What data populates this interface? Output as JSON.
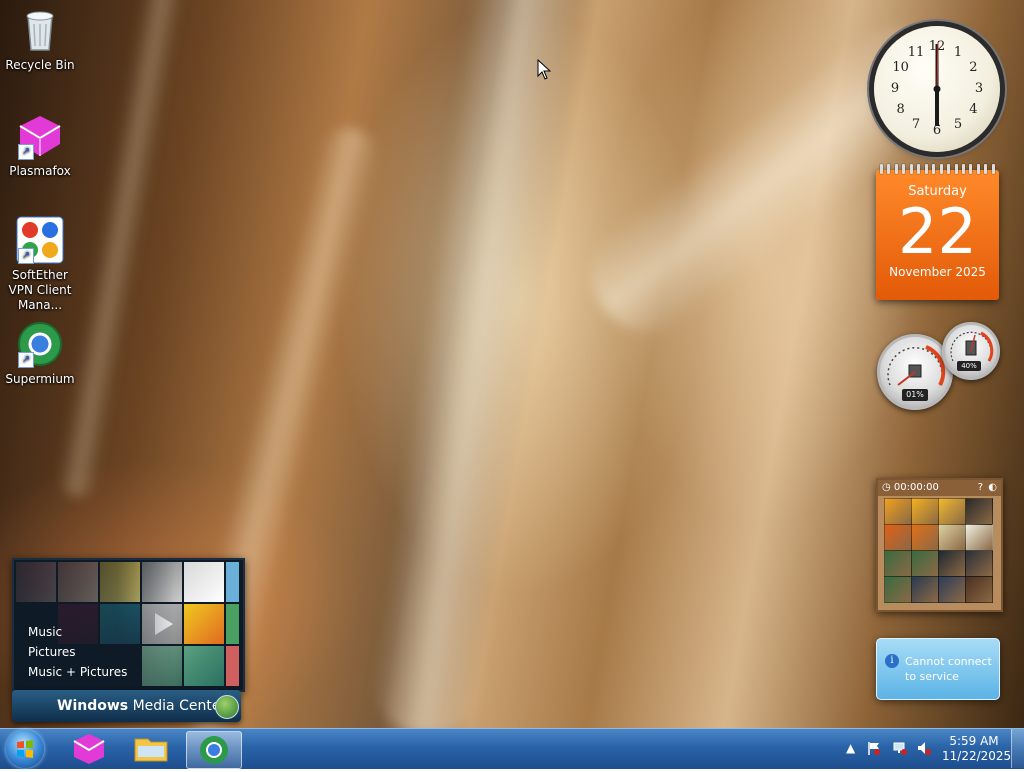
{
  "desktop_icons": [
    {
      "label": "Recycle Bin",
      "icon": "recycle-bin-icon"
    },
    {
      "label": "Plasmafox",
      "icon": "plasmafox-icon"
    },
    {
      "label": "SoftEther VPN Client Mana...",
      "icon": "softether-vpn-icon"
    },
    {
      "label": "Supermium",
      "icon": "supermium-icon"
    }
  ],
  "calendar": {
    "weekday": "Saturday",
    "day": "22",
    "month_year": "November 2025"
  },
  "clock": {
    "numerals": [
      "12",
      "1",
      "2",
      "3",
      "4",
      "5",
      "6",
      "7",
      "8",
      "9",
      "10",
      "11"
    ]
  },
  "meters": {
    "cpu": "01%",
    "memory": "40%"
  },
  "puzzle": {
    "timer": "00:00:00"
  },
  "notification": {
    "text": "Cannot connect to service"
  },
  "media_center": {
    "menu": [
      "Music",
      "Pictures",
      "Music + Pictures"
    ],
    "brand_bold": "Windows",
    "brand_light": "Media Center"
  },
  "taskbar": {
    "items": [
      "start-orb",
      "plasmafox",
      "file-explorer",
      "supermium"
    ],
    "time": "5:59 AM",
    "date": "11/22/2025"
  },
  "colors": {
    "calendar": "#e8650f",
    "taskbar": "#2a63a8",
    "notify": "#6bbbe8"
  }
}
